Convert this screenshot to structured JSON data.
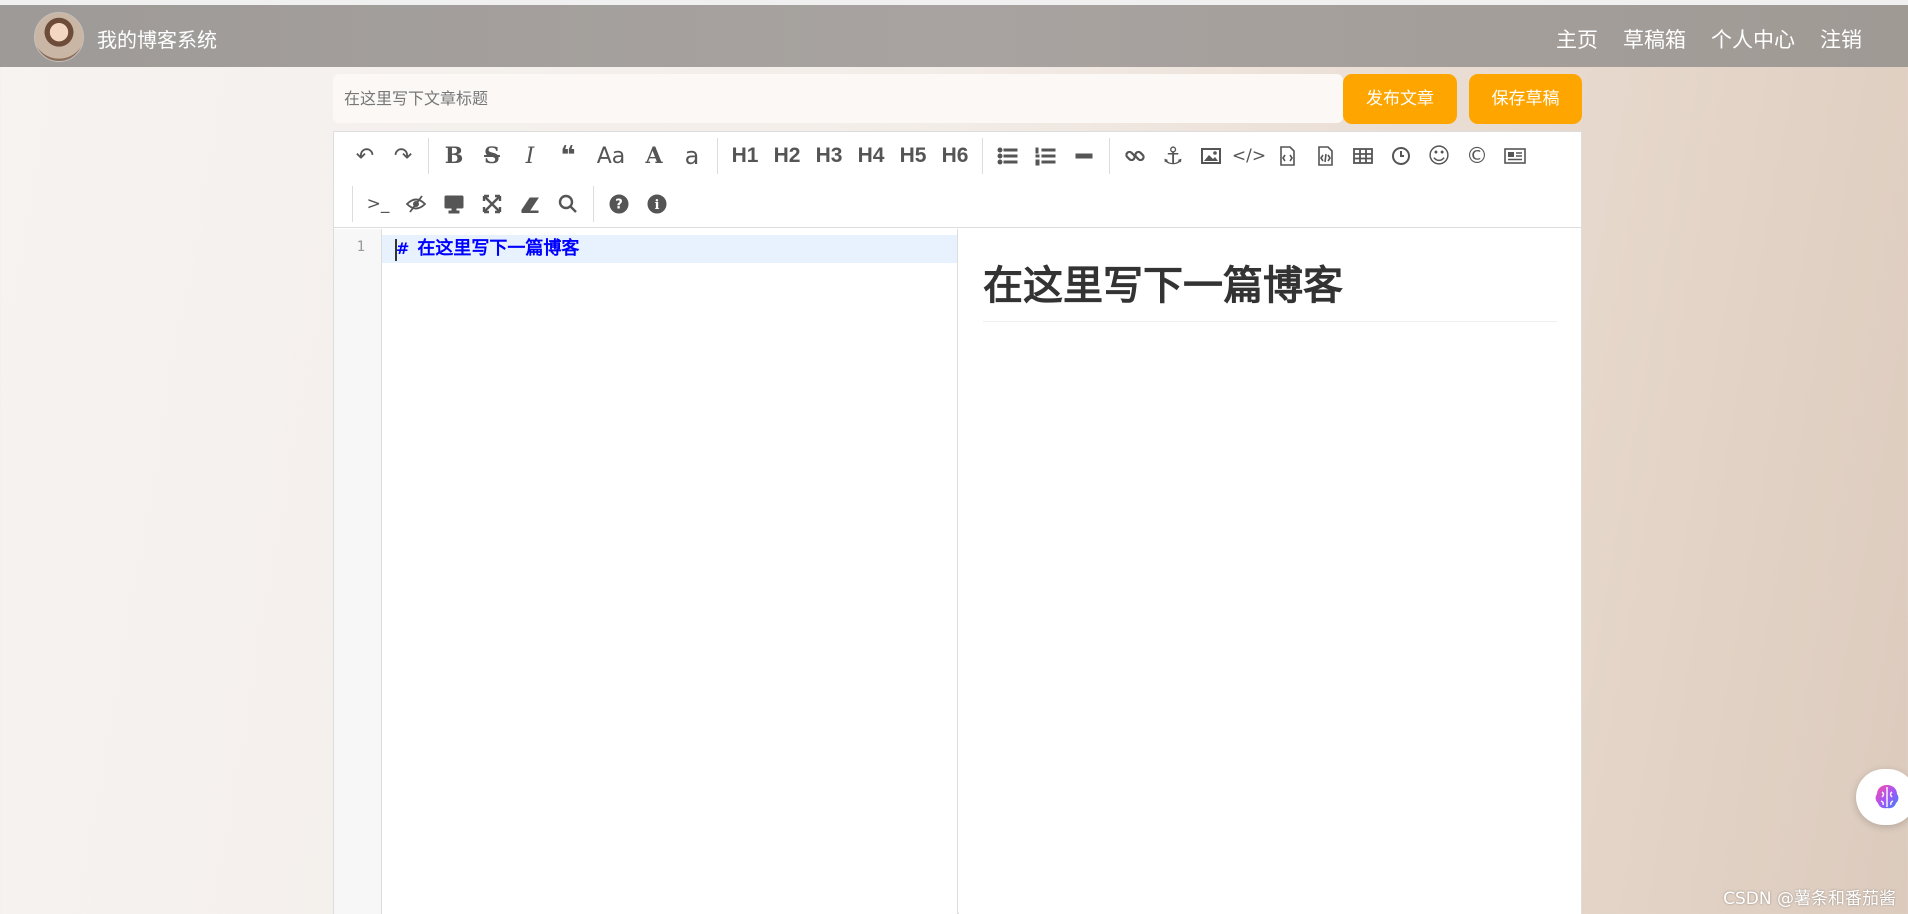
{
  "nav": {
    "brand": "我的博客系统",
    "links": [
      "主页",
      "草稿箱",
      "个人中心",
      "注销"
    ]
  },
  "title_input": {
    "placeholder": "在这里写下文章标题",
    "value": ""
  },
  "buttons": {
    "publish": "发布文章",
    "save": "保存草稿"
  },
  "toolbar": {
    "row1": [
      "undo-icon",
      "redo-icon",
      "bold-icon",
      "strikethrough-icon",
      "italic-icon",
      "quote-icon",
      "uppercase-icon",
      "ucwords-icon",
      "lowercase-icon",
      "h1",
      "h2",
      "h3",
      "h4",
      "h5",
      "h6",
      "unordered-list-icon",
      "ordered-list-icon",
      "horizontal-rule-icon",
      "link-icon",
      "anchor-icon",
      "image-icon",
      "code-icon",
      "preformatted-code-icon",
      "code-block-icon",
      "table-icon",
      "datetime-icon",
      "emoji-icon",
      "html-entities-icon",
      "pagebreak-icon"
    ],
    "row2": [
      "terminal-icon",
      "watch-toggle-icon",
      "preview-icon",
      "fullscreen-icon",
      "clear-icon",
      "search-icon",
      "help-icon",
      "info-icon"
    ],
    "labels": {
      "uppercase": "Aa",
      "ucwords": "A",
      "lowercase": "a",
      "h1": "H1",
      "h2": "H2",
      "h3": "H3",
      "h4": "H4",
      "h5": "H5",
      "h6": "H6",
      "terminal": ">_"
    }
  },
  "editor": {
    "line_number": "1",
    "line_hash": "#",
    "line_text": "在这里写下一篇博客"
  },
  "preview": {
    "heading": "在这里写下一篇博客"
  },
  "watermark": "CSDN @薯条和番茄酱",
  "colors": {
    "accent": "#ffa500",
    "code_text": "#0000ff",
    "navbar": "#a6a19d"
  }
}
